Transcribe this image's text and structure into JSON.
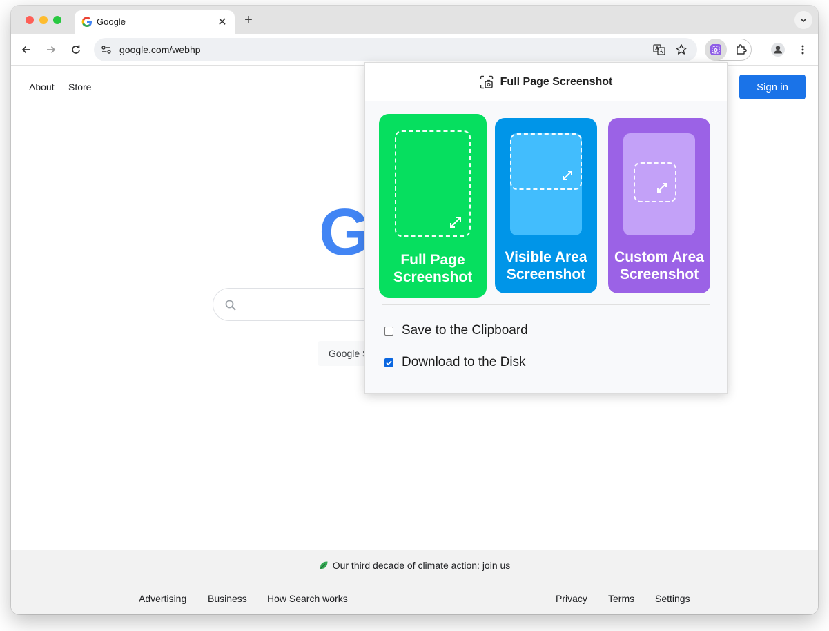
{
  "browser": {
    "tab_title": "Google",
    "url": "google.com/webhp",
    "new_tab_symbol": "+",
    "close_symbol": "✕"
  },
  "page": {
    "nav": {
      "about": "About",
      "store": "Store"
    },
    "sign_in": "Sign in",
    "logo_letter": "G",
    "search_button": "Google S",
    "footer": {
      "climate": "Our third decade of climate action: join us",
      "left_links": [
        "Advertising",
        "Business",
        "How Search works"
      ],
      "right_links": [
        "Privacy",
        "Terms",
        "Settings"
      ]
    }
  },
  "popup": {
    "title": "Full Page Screenshot",
    "cards": [
      {
        "label_line1": "Full Page",
        "label_line2": "Screenshot",
        "color": "#06df5f"
      },
      {
        "label_line1": "Visible Area",
        "label_line2": "Screenshot",
        "color": "#0095e8"
      },
      {
        "label_line1": "Custom Area",
        "label_line2": "Screenshot",
        "color": "#9b62e6"
      }
    ],
    "options": [
      {
        "label": "Save to the Clipboard",
        "checked": false
      },
      {
        "label": "Download to the Disk",
        "checked": true
      }
    ]
  },
  "colors": {
    "accent_blue": "#1a73e8",
    "google_blue": "#4285f4"
  }
}
